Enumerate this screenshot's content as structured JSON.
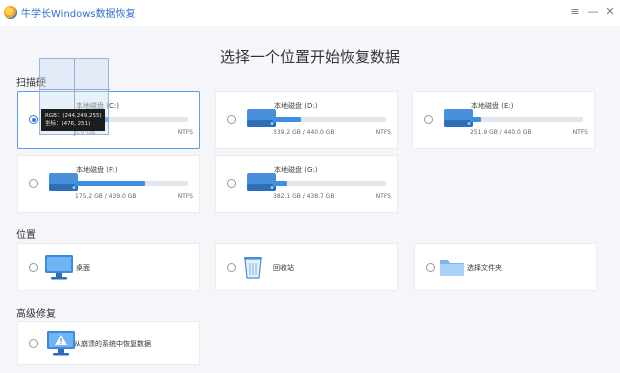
{
  "window": {
    "title": "牛学长Windows数据恢复",
    "controls": [
      "≡",
      "—",
      "✕"
    ]
  },
  "heading": "选择一个位置开始恢复数据",
  "sections": {
    "scan": "扫描硬",
    "location": "位置",
    "advanced": "高级修复"
  },
  "drives": [
    {
      "name": "本地磁盘 (C:)",
      "size": "0.0 GB",
      "fs": "NTFS",
      "used_fraction": 0.3,
      "selected": true
    },
    {
      "name": "本地磁盘 (D:)",
      "size": "339.2 GB / 440.0 GB",
      "fs": "NTFS",
      "used_fraction": 0.25,
      "selected": false
    },
    {
      "name": "本地磁盘 (E:)",
      "size": "251.9 GB / 440.0 GB",
      "fs": "NTFS",
      "used_fraction": 0.1,
      "selected": false
    },
    {
      "name": "本地磁盘 (F:)",
      "size": "175.2 GB / 439.0 GB",
      "fs": "NTFS",
      "used_fraction": 0.62,
      "selected": false
    },
    {
      "name": "本地磁盘 (G:)",
      "size": "382.1 GB / 438.7 GB",
      "fs": "NTFS",
      "used_fraction": 0.12,
      "selected": false
    }
  ],
  "locations": {
    "desktop": "桌面",
    "recycle": "回收站",
    "folder": "选择文件夹"
  },
  "advanced": {
    "crashed": "从崩溃的系统中恢复数据"
  },
  "tooltip": {
    "rgb": "RGB：(244,249,255)",
    "coord": "坐标：(476, 251)"
  },
  "colors": {
    "accent": "#3f8fe0",
    "title": "#2e6fcf",
    "background": "#f4f6f9"
  }
}
